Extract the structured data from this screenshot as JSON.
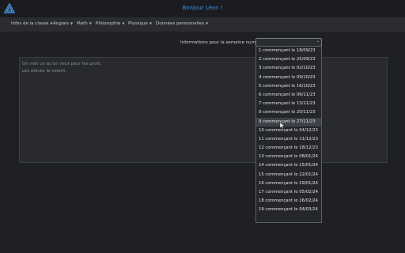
{
  "header": {
    "greeting": "Bonjour Léon !"
  },
  "nav": {
    "items": [
      {
        "label": "Infos de la classe"
      },
      {
        "label": "Anglais"
      },
      {
        "label": "Math"
      },
      {
        "label": "Philosophie"
      },
      {
        "label": "Physique"
      },
      {
        "label": "Données personnelles"
      }
    ]
  },
  "week": {
    "label": "Informations pour la semaine numéro",
    "selected": "",
    "options": [
      "1 commençant le 18/09/23",
      "2 commençant le 25/09/23",
      "3 commençant le 02/10/23",
      "4 commençant le 09/10/23",
      "5 commençant le 16/10/23",
      "6 commençant le 06/11/23",
      "7 commençant le 13/11/23",
      "8 commençant le 20/11/23",
      "9 commençant le 27/11/23",
      "10 commençant le 04/12/23",
      "11 commençant le 11/12/23",
      "12 commençant le 18/12/23",
      "13 commençant le 08/01/24",
      "14 commençant le 15/01/24",
      "15 commençant le 22/01/24",
      "16 commençant le 29/01/24",
      "17 commençant le 05/02/24",
      "18 commençant le 26/02/24",
      "19 commençant le 04/03/24"
    ],
    "hovered_option": "9 commençant le 27/11/23"
  },
  "notes": {
    "line1": "On met ce qu'on veut pour les profs.",
    "line2": "Les élèves le voient."
  },
  "icons": {
    "logo": "triangle-logo-icon",
    "chevron": "chevron-down-icon",
    "cursor": "mouse-pointer-icon"
  },
  "colors": {
    "accent": "#3d8fe0",
    "background": "#1f2024"
  }
}
